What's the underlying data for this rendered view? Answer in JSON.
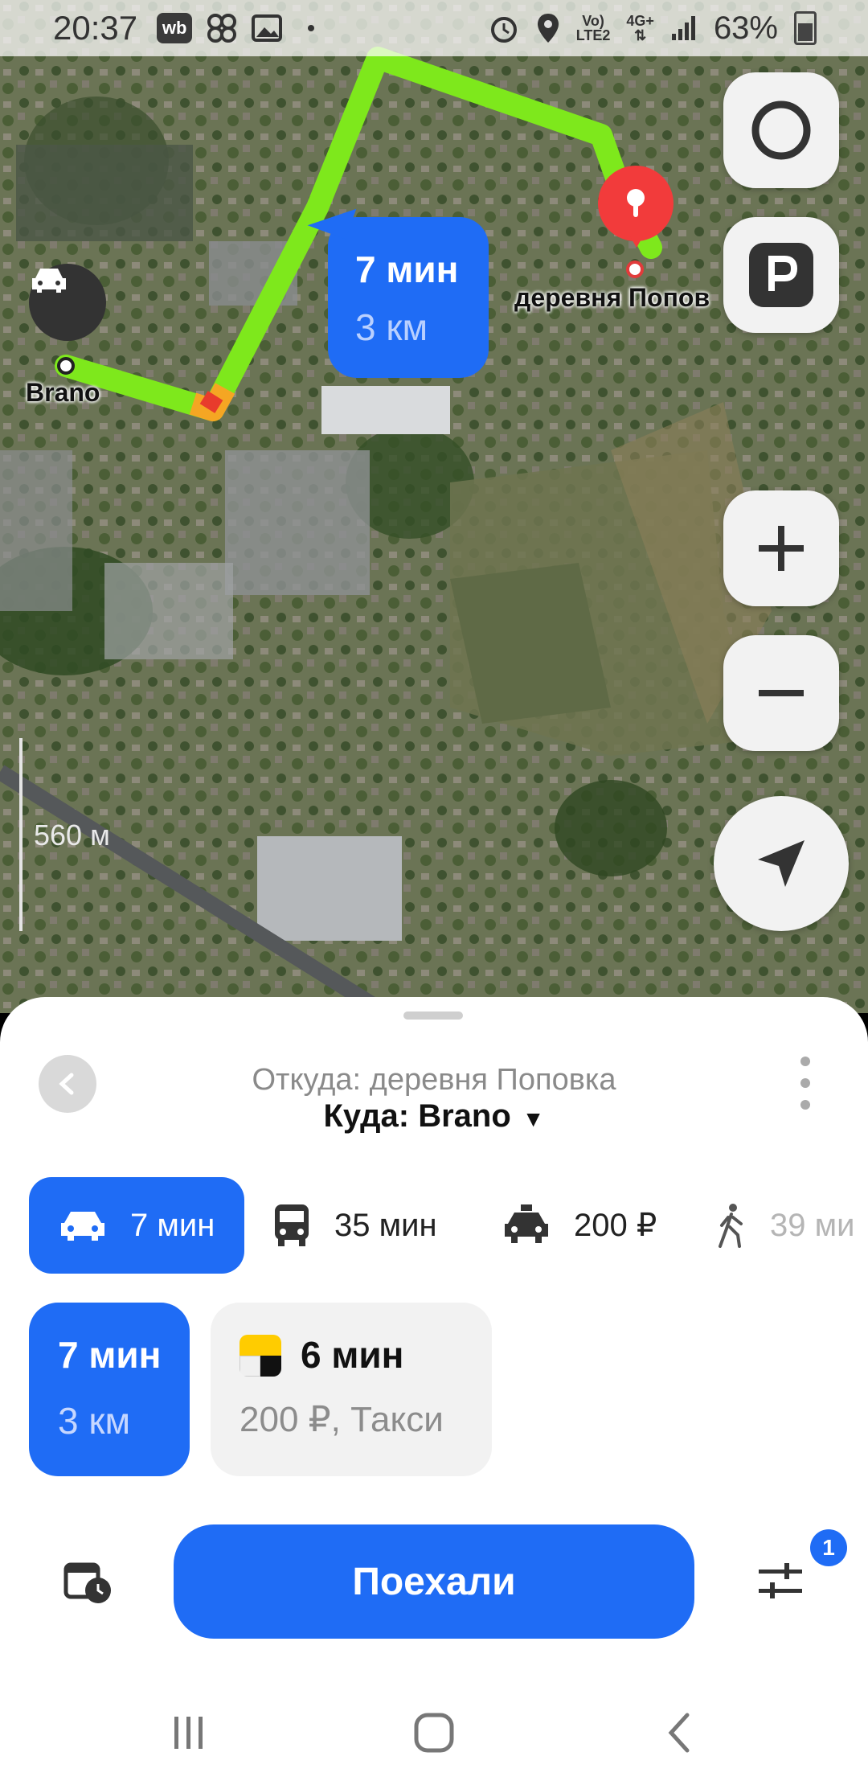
{
  "status_bar": {
    "time": "20:37",
    "app_chip": "wb",
    "net_top": "Vo)",
    "net_bottom": "LTE2",
    "net2_top": "4G+",
    "battery": "63%"
  },
  "map": {
    "route_bubble": {
      "time": "7 мин",
      "distance": "3 км"
    },
    "origin_label": "Brano",
    "destination_label": "деревня Попов",
    "scale": "560 м",
    "icons": [
      "alice-icon",
      "parking-icon",
      "zoom-in-icon",
      "zoom-out-icon",
      "locate-icon",
      "car-icon",
      "pin-icon"
    ]
  },
  "sheet": {
    "from": "Откуда: деревня Поповка",
    "to": "Куда: Brano",
    "modes": [
      {
        "icon": "car-icon",
        "label": "7 мин",
        "active": true
      },
      {
        "icon": "bus-icon",
        "label": "35 мин",
        "active": false
      },
      {
        "icon": "taxi-icon",
        "label": "200 ₽",
        "active": false
      },
      {
        "icon": "walk-icon",
        "label": "39 ми",
        "active": false
      }
    ],
    "options": [
      {
        "line1": "7 мин",
        "line2": "3 км"
      },
      {
        "line1": "6 мин",
        "line2": "200 ₽, Такси"
      }
    ],
    "go_button": "Поехали",
    "filter_badge": "1"
  },
  "colors": {
    "accent": "#1f6cf5",
    "route": "#7ee81c",
    "pin": "#f23b3b"
  }
}
